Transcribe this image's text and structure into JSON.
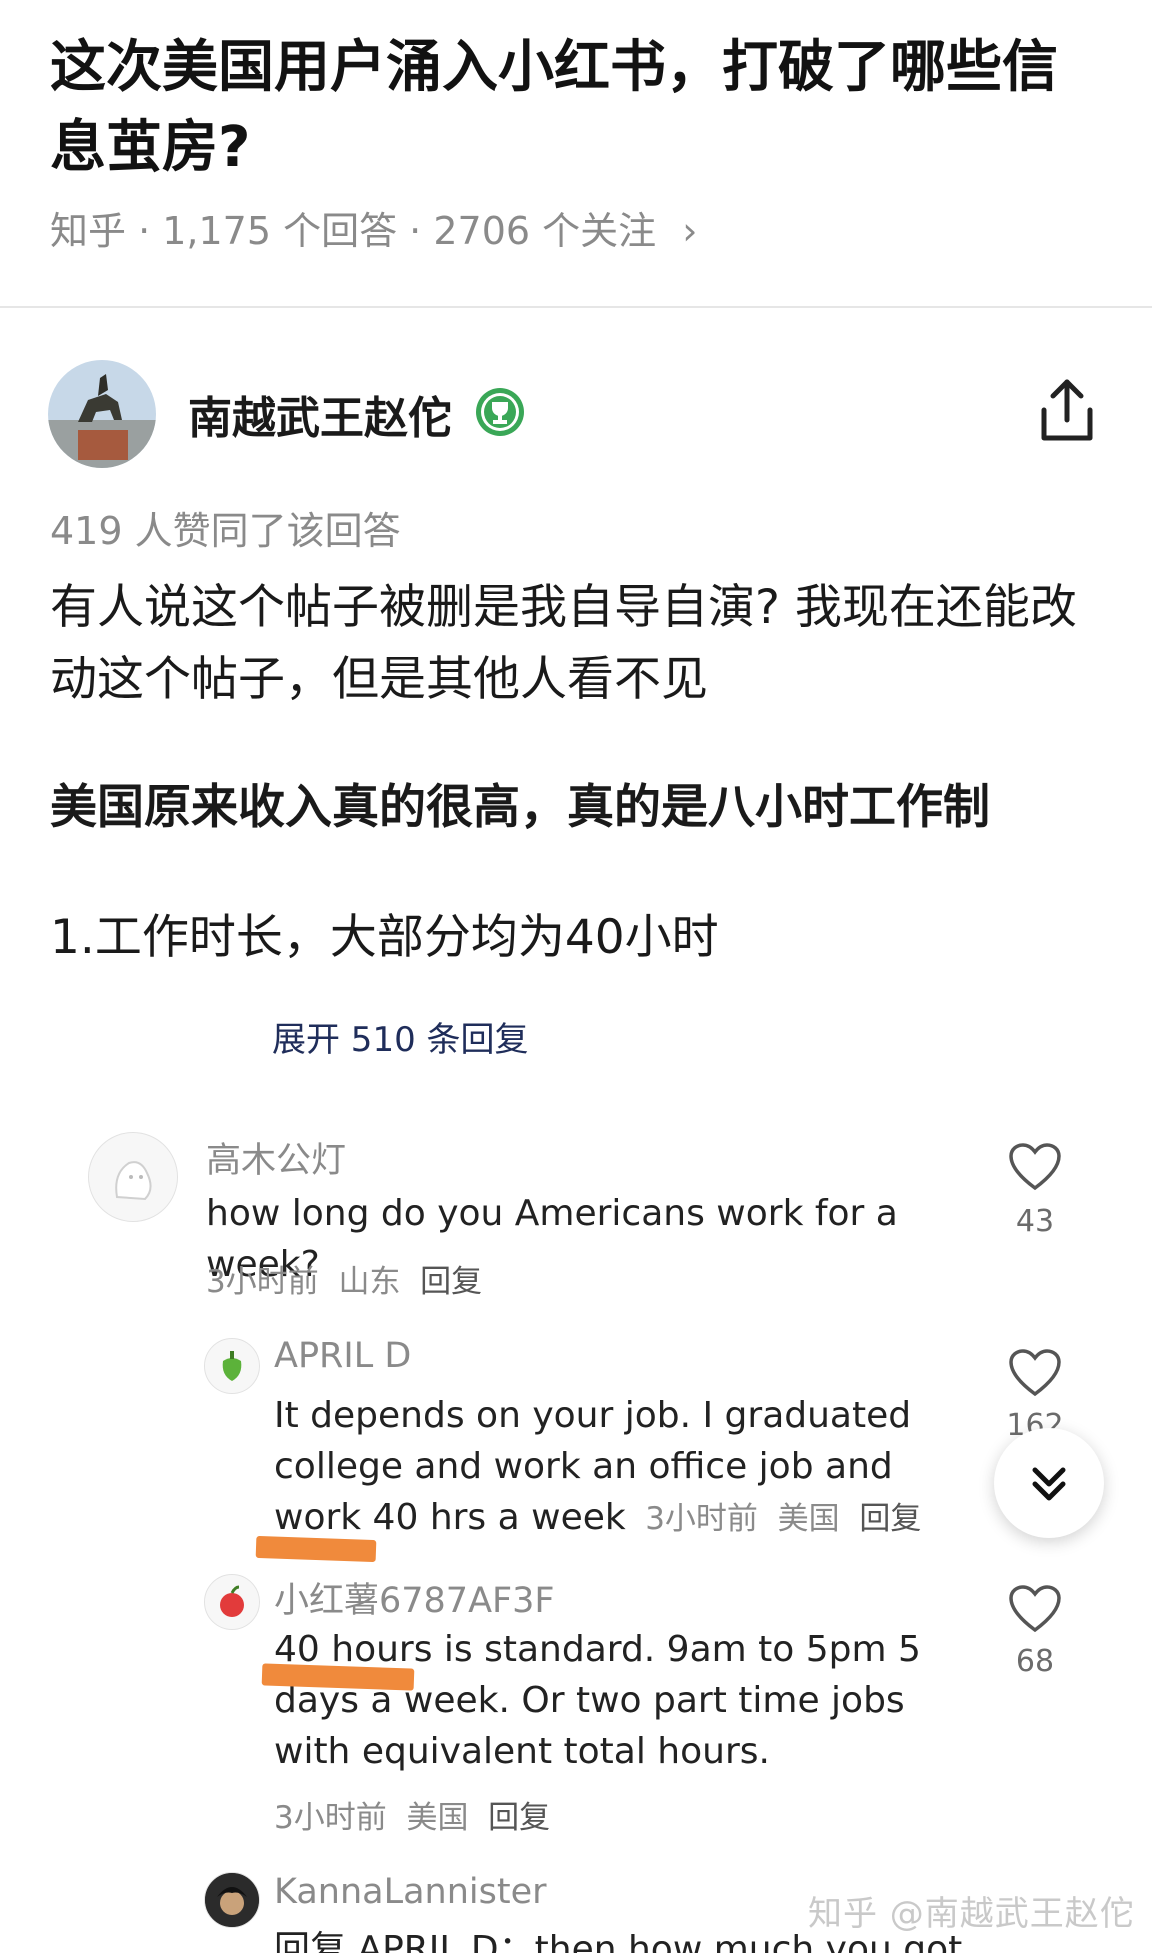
{
  "question": {
    "title": "这次美国用户涌入小红书，打破了哪些信息茧房?",
    "meta": "知乎 · 1,175 个回答 · 2706 个关注",
    "meta_arrow": "›"
  },
  "answer": {
    "author_name": "南越武王赵佗",
    "badge_icon": "trophy-badge-icon",
    "share_icon": "share-icon",
    "votes_text": "419 人赞同了该回答",
    "paragraphs": [
      "有人说这个帖子被删是我自导自演? 我现在还能改动这个帖子，但是其他人看不见",
      "美国原来收入真的很高，真的是八小时工作制",
      "1.工作时长，大部分均为40小时"
    ]
  },
  "comments_screenshot": {
    "cut_off_text": "展开 510 条回复",
    "comments": [
      {
        "name": "高木公灯",
        "text": "how long do you Americans work for a week?",
        "time": "3小时前",
        "location": "山东",
        "reply": "回复",
        "likes": "43"
      },
      {
        "name": "APRIL D",
        "text": "It depends on your job. I graduated college and work an office job and work 40 hrs a week",
        "time": "3小时前",
        "location": "美国",
        "reply": "回复",
        "likes": "162"
      },
      {
        "name": "小红薯6787AF3F",
        "text": "40 hours is standard. 9am to 5pm 5 days a week. Or two part time jobs with equivalent total hours.",
        "time": "3小时前",
        "location": "美国",
        "reply": "回复",
        "likes": "68"
      },
      {
        "name": "KannaLannister",
        "text": "回复 APRIL D：then how much you got"
      }
    ],
    "scroll_down_icon": "double-chevron-down-icon"
  },
  "watermark": "知乎 @南越武王赵佗",
  "colors": {
    "highlight": "#f08a3c",
    "badge_green": "#3aa757",
    "text_dark": "#1a1a1a",
    "text_gray": "#8a8a8a"
  }
}
